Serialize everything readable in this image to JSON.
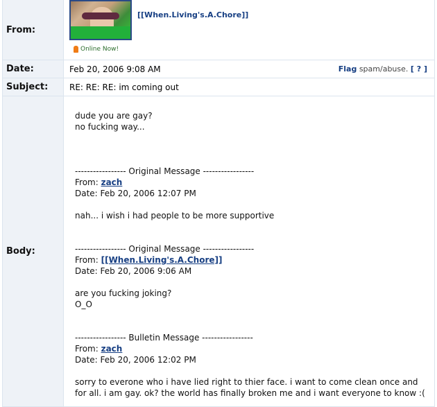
{
  "labels": {
    "from": "From:",
    "date": "Date:",
    "subject": "Subject:",
    "body": "Body:"
  },
  "from": {
    "sender_name": "[[When.Living's.A.Chore]]",
    "online_status": "Online Now!"
  },
  "date": {
    "value": "Feb 20, 2006 9:08 AM",
    "flag_label": "Flag",
    "flag_suffix": " spam/abuse. ",
    "help_label": "[ ? ]"
  },
  "subject": {
    "value": "RE: RE: RE: im coming out"
  },
  "body": {
    "line1": "dude you are gay?",
    "line2": "no fucking way...",
    "orig1_header": "----------------- Original Message -----------------",
    "orig1_from_label": "From: ",
    "orig1_from_name": "zach",
    "orig1_date": "Date: Feb 20, 2006 12:07 PM",
    "orig1_text": "nah... i wish i had people to be more supportive",
    "orig2_header": "----------------- Original Message -----------------",
    "orig2_from_label": "From: ",
    "orig2_from_name": "[[When.Living's.A.Chore]]",
    "orig2_date": "Date: Feb 20, 2006 9:06 AM",
    "orig2_text1": "are you fucking joking?",
    "orig2_text2": "O_O",
    "bulletin_header": "----------------- Bulletin Message -----------------",
    "bulletin_from_label": "From: ",
    "bulletin_from_name": "zach",
    "bulletin_date": "Date: Feb 20, 2006 12:02 PM",
    "bulletin_text": "sorry to everone who i have lied right to thier face. i want to come clean once and for all. i am gay. ok? the world has finally broken me and i want everyone to know :("
  },
  "colors": {
    "label_bg": "#eef2f7",
    "border": "#dbe4ee",
    "link": "#173f83",
    "online_icon": "#f07c16"
  }
}
